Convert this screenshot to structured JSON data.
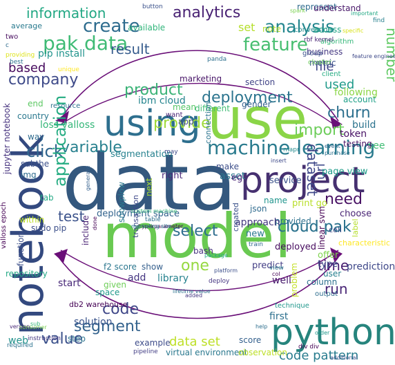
{
  "words": [
    {
      "text": "data",
      "c": "#34587e"
    },
    {
      "text": "model",
      "c": "#69c951"
    },
    {
      "text": "use",
      "c": "#8ad547"
    },
    {
      "text": "notebook",
      "c": "#33497f"
    },
    {
      "text": "python",
      "c": "#26847d"
    },
    {
      "text": "project",
      "c": "#463070"
    },
    {
      "text": "using",
      "c": "#2e6f8e"
    },
    {
      "text": "machine learning",
      "c": "#2a7b8e"
    },
    {
      "text": "pak data",
      "c": "#3fbb75"
    },
    {
      "text": "feature",
      "c": "#47be70"
    },
    {
      "text": "analysis",
      "c": "#24868e"
    },
    {
      "text": "analytics",
      "c": "#482173"
    },
    {
      "text": "create",
      "c": "#2e6c8e"
    },
    {
      "text": "information",
      "c": "#22a884"
    },
    {
      "text": "company",
      "c": "#3e4a89"
    },
    {
      "text": "based",
      "c": "#460a5d"
    },
    {
      "text": "deployment",
      "c": "#2b748e"
    },
    {
      "text": "product",
      "c": "#3bb377"
    },
    {
      "text": "file",
      "c": "#3f4788"
    },
    {
      "text": "number",
      "c": "#5ec962"
    },
    {
      "text": "used",
      "c": "#1f9a8a"
    },
    {
      "text": "churn",
      "c": "#2d708e"
    },
    {
      "text": "import",
      "c": "#6ccd5a"
    },
    {
      "text": "provide",
      "c": "#9fda3a"
    },
    {
      "text": "click",
      "c": "#31668e"
    },
    {
      "text": "variable",
      "c": "#27808e"
    },
    {
      "text": "application",
      "c": "#25ac82"
    },
    {
      "text": "dataset",
      "c": "#3f4889"
    },
    {
      "text": "test",
      "c": "#3b528b"
    },
    {
      "text": "cloud pak",
      "c": "#2c738e"
    },
    {
      "text": "need",
      "c": "#471063"
    },
    {
      "text": "select",
      "c": "#2e6d8e"
    },
    {
      "text": "one",
      "c": "#95d840"
    },
    {
      "text": "code",
      "c": "#3f4788"
    },
    {
      "text": "segment",
      "c": "#33628d"
    },
    {
      "text": "value",
      "c": "#3b518b"
    },
    {
      "text": "run",
      "c": "#482475"
    },
    {
      "text": "time",
      "c": "#482071"
    },
    {
      "text": "code pattern",
      "c": "#287c8e"
    },
    {
      "text": "data set",
      "c": "#bddf26"
    },
    {
      "text": "result",
      "c": "#365c8d"
    },
    {
      "text": "set",
      "c": "#b5de2b"
    },
    {
      "text": "url",
      "c": "#3e4989"
    },
    {
      "text": "pip install",
      "c": "#20938c"
    },
    {
      "text": "segmentation",
      "c": "#26818e"
    },
    {
      "text": "loss valloss",
      "c": "#35b779"
    },
    {
      "text": "ibm cloud",
      "c": "#25858e"
    },
    {
      "text": "deployment space",
      "c": "#33638d"
    },
    {
      "text": "available",
      "c": "#31b57b"
    },
    {
      "text": "business",
      "c": "#453882"
    },
    {
      "text": "metric",
      "c": "#3b518b"
    },
    {
      "text": "account",
      "c": "#1fa088"
    },
    {
      "text": "following",
      "c": "#8bd646"
    },
    {
      "text": "build",
      "c": "#2c738e"
    },
    {
      "text": "token",
      "c": "#471164"
    },
    {
      "text": "see",
      "c": "#3fbc73"
    },
    {
      "text": "page view",
      "c": "#1e9c89"
    },
    {
      "text": "choose",
      "c": "#482374"
    },
    {
      "text": "print go",
      "c": "#b8de29"
    },
    {
      "text": "cloud pak",
      "c": "#2c738e"
    },
    {
      "text": "provided",
      "c": "#2d718e"
    },
    {
      "text": "deployed",
      "c": "#460b5e"
    },
    {
      "text": "predict",
      "c": "#433e85"
    },
    {
      "text": "offer",
      "c": "#7fd34e"
    },
    {
      "text": "type",
      "c": "#3d4d8a"
    },
    {
      "text": "user",
      "c": "#277f8e"
    },
    {
      "text": "well",
      "c": "#481b6d"
    },
    {
      "text": "start",
      "c": "#482878"
    },
    {
      "text": "solution",
      "c": "#3a548c"
    },
    {
      "text": "step",
      "c": "#2c738e"
    },
    {
      "text": "example",
      "c": "#3e4c8a"
    },
    {
      "text": "score",
      "c": "#34608d"
    },
    {
      "text": "virtual environment",
      "c": "#2a788e"
    },
    {
      "text": "observation",
      "c": "#bddf26"
    },
    {
      "text": "first",
      "c": "#2d708e"
    },
    {
      "text": "web",
      "c": "#21918c"
    },
    {
      "text": "add",
      "c": "#453581"
    },
    {
      "text": "show",
      "c": "#355f8d"
    },
    {
      "text": "f2 score",
      "c": "#2a768e"
    },
    {
      "text": "given",
      "c": "#6ece58"
    },
    {
      "text": "space",
      "c": "#1f998a"
    },
    {
      "text": "new",
      "c": "#2a788e"
    },
    {
      "text": "json",
      "c": "#2f6b8e"
    },
    {
      "text": "approach",
      "c": "#44397f"
    },
    {
      "text": "created",
      "c": "#3b528b"
    },
    {
      "text": "name",
      "c": "#1f948c"
    },
    {
      "text": "make",
      "c": "#3d4e8a"
    },
    {
      "text": "asset",
      "c": "#2a778e"
    },
    {
      "text": "eg",
      "c": "#482475"
    },
    {
      "text": "service",
      "c": "#3b528b"
    },
    {
      "text": "right",
      "c": "#482878"
    },
    {
      "text": "next",
      "c": "#aadc32"
    },
    {
      "text": "snowplow",
      "c": "#2a788e"
    },
    {
      "text": "transaction",
      "c": "#3e4989"
    },
    {
      "text": "jupyter notebook",
      "c": "#46327e"
    },
    {
      "text": "subthe",
      "c": "#3c508b"
    },
    {
      "text": "img",
      "c": "#2f6c8e"
    },
    {
      "text": "way",
      "c": "#2f6b8e"
    },
    {
      "text": "country",
      "c": "#2a788e"
    },
    {
      "text": "end",
      "c": "#5cc863"
    },
    {
      "text": "within",
      "c": "#bddf26"
    },
    {
      "text": "sudo pip",
      "c": "#3c4f8a"
    },
    {
      "text": "valloss epoch",
      "c": "#440154"
    },
    {
      "text": "repository",
      "c": "#22a884"
    },
    {
      "text": "tab",
      "c": "#22a884"
    },
    {
      "text": "app",
      "c": "#3e4a89"
    },
    {
      "text": "mean",
      "c": "#56c667"
    },
    {
      "text": "different",
      "c": "#3fbc73"
    },
    {
      "text": "gender",
      "c": "#355f8d"
    },
    {
      "text": "marketing",
      "c": "#481668"
    },
    {
      "text": "section",
      "c": "#414487"
    },
    {
      "text": "connection",
      "c": "#2b748e"
    },
    {
      "text": "want",
      "c": "#482173"
    },
    {
      "text": "note",
      "c": "#b5de2b"
    },
    {
      "text": "conversion",
      "c": "#238a8d"
    },
    {
      "text": "access",
      "c": "#20a386"
    },
    {
      "text": "represent",
      "c": "#2f6b8e"
    },
    {
      "text": "average",
      "c": "#297a8e"
    },
    {
      "text": "understand",
      "c": "#481769"
    },
    {
      "text": "cell",
      "c": "#3e4a89"
    },
    {
      "text": "db2 warehouse",
      "c": "#440154"
    },
    {
      "text": "linear svm",
      "c": "#440154"
    },
    {
      "text": "problem",
      "c": "#c2df23"
    },
    {
      "text": "output",
      "c": "#2e6e8e"
    },
    {
      "text": "technique",
      "c": "#1f978b"
    },
    {
      "text": "prediction",
      "c": "#3f4889"
    },
    {
      "text": "column",
      "c": "#2d708e"
    },
    {
      "text": "characteristic",
      "c": "#fde725"
    },
    {
      "text": "cluster",
      "c": "#6ccd5a"
    },
    {
      "text": "client",
      "c": "#25ac82"
    },
    {
      "text": "group",
      "c": "#3b528b"
    },
    {
      "text": "include",
      "c": "#482173"
    },
    {
      "text": "library",
      "c": "#26828e"
    },
    {
      "text": "label",
      "c": "#b5de2b"
    },
    {
      "text": "resource",
      "c": "#2c728e"
    },
    {
      "text": "algorithm",
      "c": "#35b779"
    },
    {
      "text": "function",
      "c": "#3c4f8a"
    },
    {
      "text": "bash",
      "c": "#46327e"
    },
    {
      "text": "testing",
      "c": "#471164"
    },
    {
      "text": "event",
      "c": "#31688e"
    },
    {
      "text": "button",
      "c": "#3b528b"
    },
    {
      "text": "two",
      "c": "#460b5e"
    },
    {
      "text": "c",
      "c": "#2f6c8e"
    },
    {
      "text": "providing",
      "c": "#dde318"
    },
    {
      "text": "best",
      "c": "#2c728e"
    },
    {
      "text": "unique",
      "c": "#fde725"
    },
    {
      "text": "find",
      "c": "#27808e"
    },
    {
      "text": "important",
      "c": "#22a884"
    },
    {
      "text": "specific",
      "c": "#d8e219"
    },
    {
      "text": "spark",
      "c": "#7ad151"
    },
    {
      "text": "div div",
      "c": "#440154"
    },
    {
      "text": "additional",
      "c": "#3a548c"
    },
    {
      "text": "pipeline",
      "c": "#433e85"
    },
    {
      "text": "required",
      "c": "#2c728e"
    },
    {
      "text": "instruction",
      "c": "#453882"
    },
    {
      "text": "sub",
      "c": "#35b779"
    },
    {
      "text": "order",
      "c": "#1f978b"
    },
    {
      "text": "help",
      "c": "#2e6e8e"
    },
    {
      "text": "col",
      "c": "#440154"
    },
    {
      "text": "deploy",
      "c": "#453581"
    },
    {
      "text": "package",
      "c": "#22a884"
    },
    {
      "text": "version",
      "c": "#482878"
    },
    {
      "text": "consumer",
      "c": "#7ad151"
    },
    {
      "text": "purchase",
      "c": "#2c728e"
    },
    {
      "text": "insert",
      "c": "#3e4989"
    },
    {
      "text": "mapr",
      "c": "#238a8d"
    },
    {
      "text": "may",
      "c": "#3e4a89"
    },
    {
      "text": "generate",
      "c": "#34608d"
    },
    {
      "text": "done",
      "c": "#440154"
    },
    {
      "text": "train",
      "c": "#31688e"
    },
    {
      "text": "platform",
      "c": "#3c4f8a"
    },
    {
      "text": "view",
      "c": "#2a788e"
    },
    {
      "text": "panda",
      "c": "#2d708e"
    },
    {
      "text": "added",
      "c": "#453882"
    },
    {
      "text": "custom machine",
      "c": "#35b779"
    },
    {
      "text": "table",
      "c": "#2d708e"
    },
    {
      "text": "hyperparameter",
      "c": "#440154"
    },
    {
      "text": "feature engineering",
      "c": "#3e4989"
    },
    {
      "text": "marketing site",
      "c": "#2a788e"
    },
    {
      "text": "lifetime value",
      "c": "#2c728e"
    },
    {
      "text": "rbf kernel",
      "c": "#482374"
    }
  ]
}
